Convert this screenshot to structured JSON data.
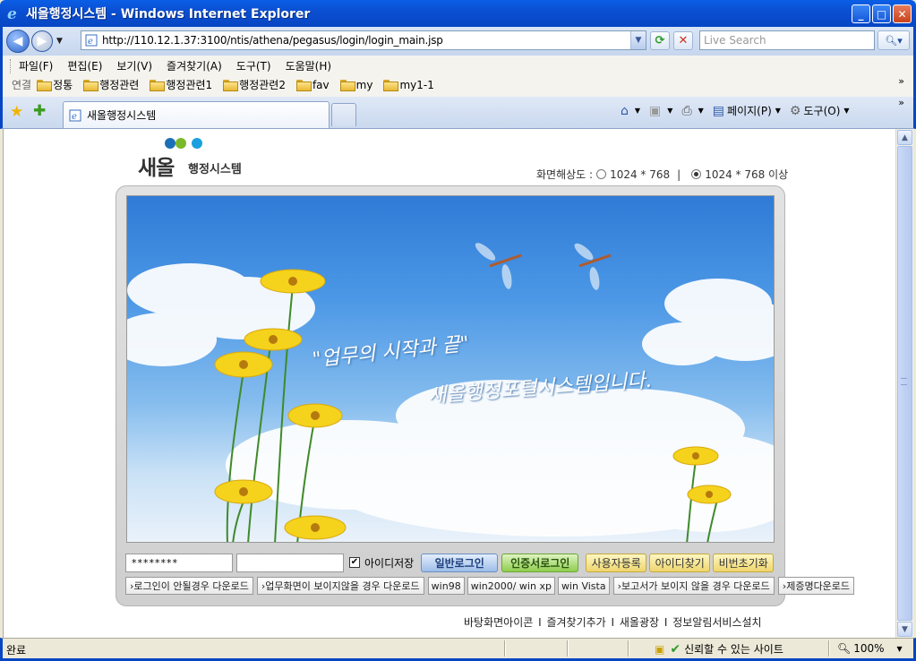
{
  "window": {
    "title": "새올행정시스템 - Windows Internet Explorer"
  },
  "address": {
    "url": "http://110.12.1.37:3100/ntis/athena/pegasus/login/login_main.jsp"
  },
  "search": {
    "placeholder": "Live Search"
  },
  "menu": [
    "파일(F)",
    "편집(E)",
    "보기(V)",
    "즐겨찾기(A)",
    "도구(T)",
    "도움말(H)"
  ],
  "links": {
    "label": "연결",
    "items": [
      "정통",
      "행정관련",
      "행정관련1",
      "행정관련2",
      "fav",
      "my",
      "my1-1"
    ]
  },
  "tab": {
    "title": "새올행정시스템"
  },
  "commands": {
    "page": "페이지(P)",
    "tools": "도구(O)"
  },
  "logo": {
    "brand": "새올",
    "sub": "행정시스템",
    "dot_colors": [
      "#1a6fb5",
      "#7ab929",
      "#1aa0e0"
    ]
  },
  "resolution": {
    "label": "화면해상도 :",
    "opt1": "1024 * 768",
    "opt2": "1024 * 768 이상",
    "selected": 2
  },
  "banner": {
    "line1": "\"업무의 시작과 끝\"",
    "line2": "새올행정포털시스템입니다."
  },
  "login": {
    "password_mask": "********",
    "save_id": "아이디저장",
    "save_id_checked": true,
    "normal_login": "일반로그인",
    "cert_login": "인증서로그인",
    "register": "사용자등록",
    "find_id": "아이디찾기",
    "reset_pw": "비번초기화"
  },
  "downloads": {
    "login_fail": "로그인이 안될경우 다운로드",
    "screen_fail": "업무화면이 보이지않을 경우 다운로드",
    "win98": "win98",
    "win2000": "win2000/ win xp",
    "vista": "win Vista",
    "report_fail": "보고서가 보이지 않을 경우 다운로드",
    "cert_dl": "제증명다운로드"
  },
  "bottom_links": [
    "바탕화면아이콘",
    "즐겨찾기추가",
    "새올광장",
    "정보알림서비스설치"
  ],
  "status": {
    "text": "완료",
    "trust": "신뢰할 수 있는 사이트",
    "zoom": "100%"
  }
}
